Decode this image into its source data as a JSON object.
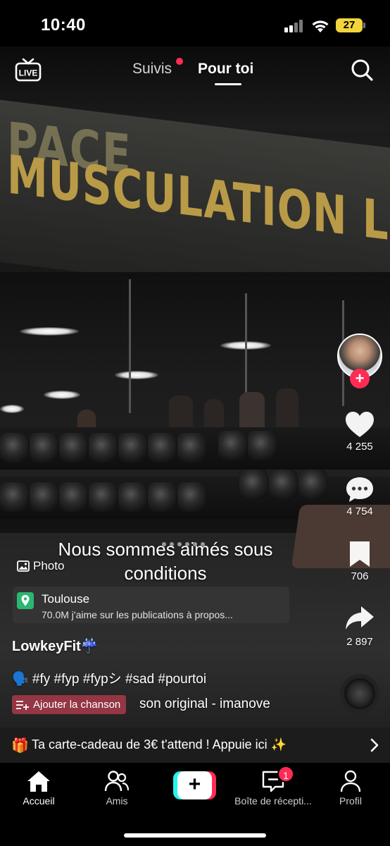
{
  "status_bar": {
    "time": "10:40",
    "battery": "27"
  },
  "top_nav": {
    "following_label": "Suivis",
    "foryou_label": "Pour toi"
  },
  "photo": {
    "sign_line1": "PACE",
    "sign_line2": "MUSCULATION LIBRE",
    "overlay_text_line1": "Nous sommes aimés sous",
    "overlay_text_line2": "conditions",
    "badge_label": "Photo"
  },
  "location": {
    "name": "Toulouse",
    "subtitle": "70.0M j'aime sur les publications à propos..."
  },
  "post": {
    "username": "LowkeyFit☔️",
    "hashtags": "🗣️ #fy #fyp #fypシ #sad #pourtoi",
    "add_song_label": "Ajouter la chanson",
    "sound_name": "son original - imanove"
  },
  "rail": {
    "likes": "4 255",
    "comments": "4 754",
    "favorites": "706",
    "shares": "2 897"
  },
  "promo": {
    "gift": "🎁",
    "text": "Ta carte-cadeau de 3€ t'attend ! Appuie ici ✨"
  },
  "tabbar": {
    "home": "Accueil",
    "friends": "Amis",
    "inbox": "Boîte de récepti...",
    "inbox_badge": "1",
    "profile": "Profil"
  },
  "colors": {
    "accent": "#fe2c55",
    "cyan": "#25f4ee",
    "location_pin": "#2bb673"
  },
  "icons": [
    "live-icon",
    "search-icon",
    "heart-icon",
    "comment-icon",
    "bookmark-icon",
    "share-icon",
    "image-icon",
    "location-pin-icon",
    "playlist-add-icon",
    "gift-icon",
    "chevron-right-icon",
    "home-icon",
    "friends-icon",
    "create-icon",
    "inbox-icon",
    "profile-icon"
  ]
}
